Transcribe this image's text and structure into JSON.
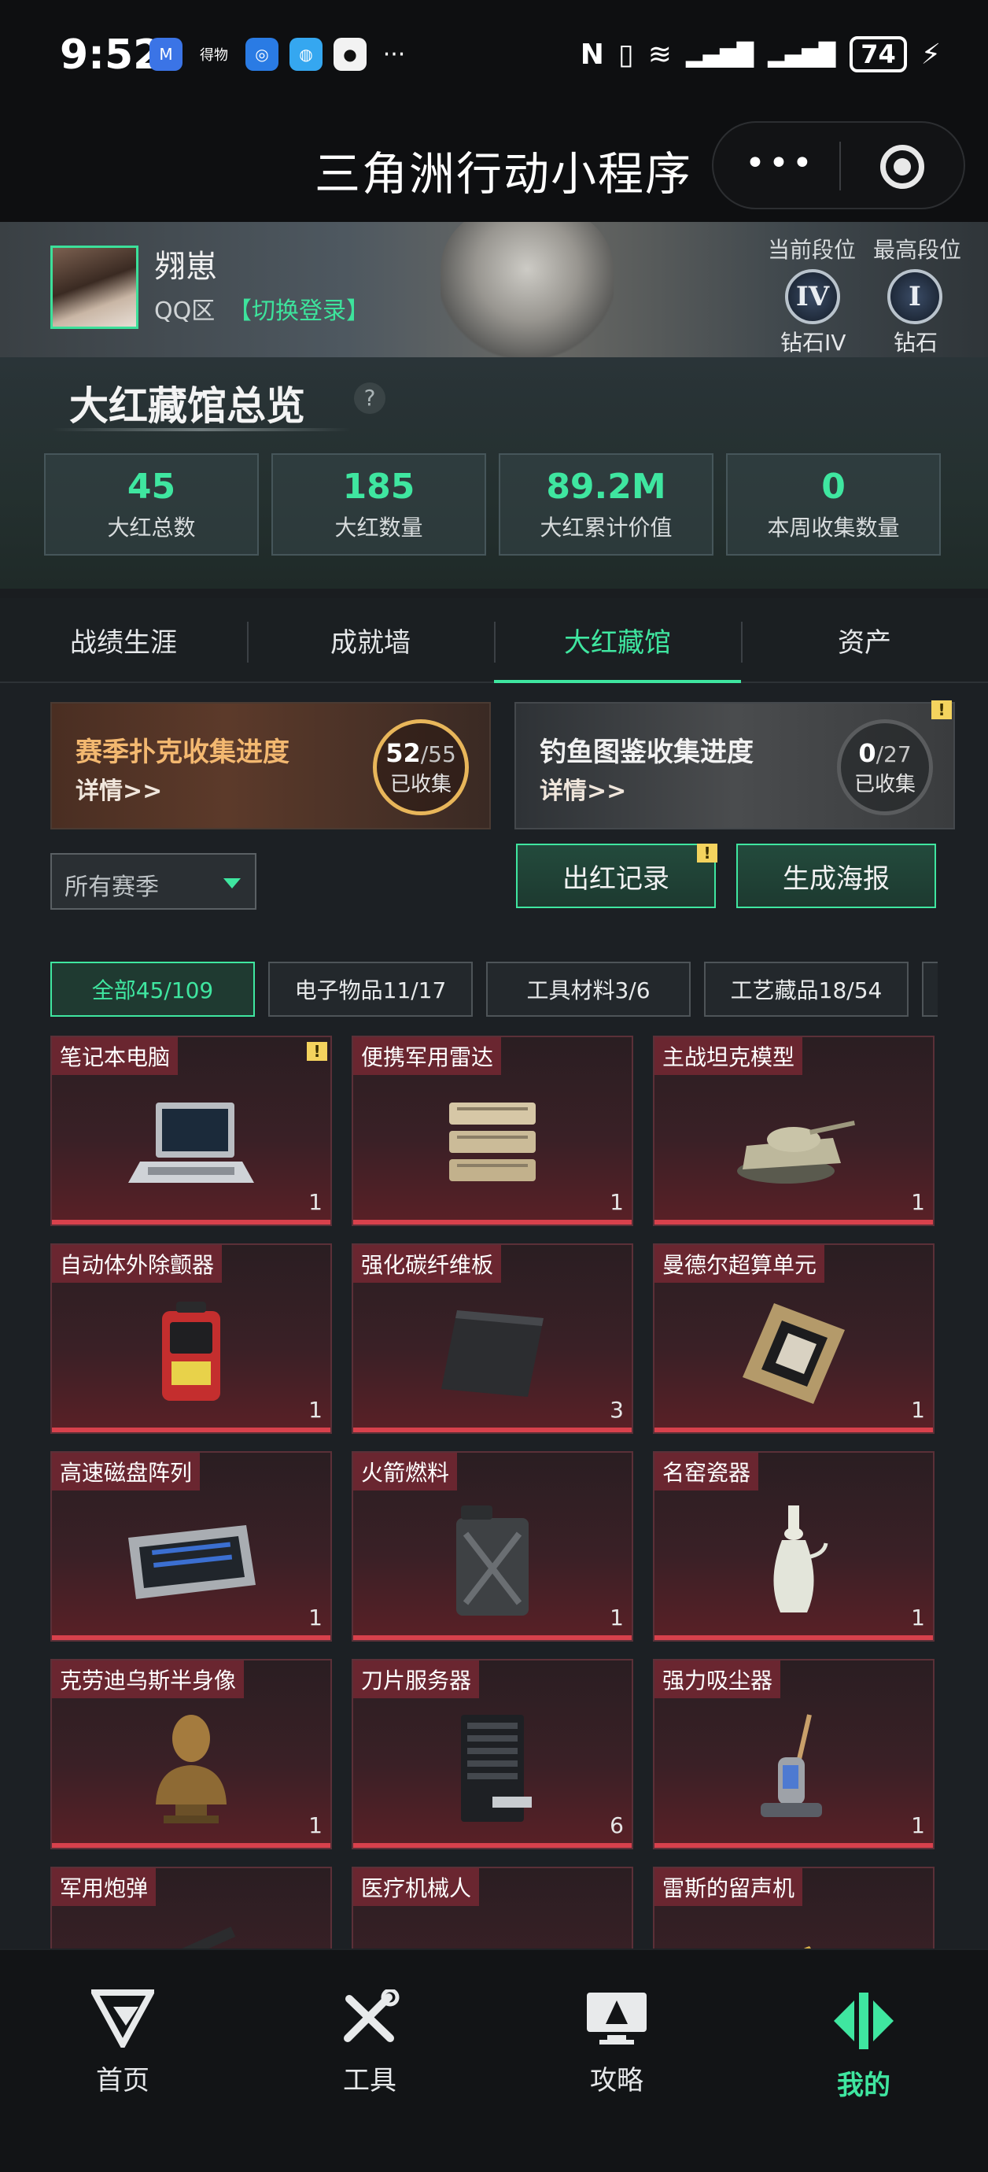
{
  "status_bar": {
    "time": "9:52",
    "apps": [
      {
        "name": "jd-icon",
        "glyph": "M",
        "color": "#3b74e6"
      },
      {
        "name": "dewu-icon",
        "glyph": "得物",
        "color": "#0e0f11"
      },
      {
        "name": "app-blue-icon",
        "glyph": "◎",
        "color": "#2a7be4"
      },
      {
        "name": "browser-icon",
        "glyph": "◍",
        "color": "#35a7f0"
      },
      {
        "name": "qq-icon",
        "glyph": "●",
        "color": "#f2f2f2"
      }
    ],
    "more": "···",
    "nfc": "N",
    "vibrate": "▯",
    "wifi": "≋",
    "signal1": "▂▄▆█",
    "signal2": "▂▄▆█",
    "battery": "74",
    "charging": "⚡"
  },
  "title_bar": {
    "title": "三角洲行动小程序",
    "more": "•••"
  },
  "profile": {
    "username": "翙崽",
    "region": "QQ区",
    "switch_login": "【切换登录】",
    "current_rank_label": "当前段位",
    "best_rank_label": "最高段位",
    "current_rank_badge": "IV",
    "best_rank_badge": "I",
    "current_rank_name": "钻石IV",
    "best_rank_name": "钻石"
  },
  "overview": {
    "title": "大红藏馆总览",
    "help": "?",
    "stats": [
      {
        "value": "45",
        "label": "大红总数"
      },
      {
        "value": "185",
        "label": "大红数量"
      },
      {
        "value": "89.2M",
        "label": "大红累计价值"
      },
      {
        "value": "0",
        "label": "本周收集数量"
      }
    ]
  },
  "tabs": [
    {
      "label": "战绩生涯",
      "active": false
    },
    {
      "label": "成就墙",
      "active": false
    },
    {
      "label": "大红藏馆",
      "active": true
    },
    {
      "label": "资产",
      "active": false
    }
  ],
  "progress": {
    "poker": {
      "title": "赛季扑克收集进度",
      "detail": "详情>>",
      "count": "52",
      "total": "/55",
      "label": "已收集"
    },
    "fish": {
      "title": "钓鱼图鉴收集进度",
      "detail": "详情>>",
      "count": "0",
      "total": "/27",
      "label": "已收集"
    }
  },
  "season_select": {
    "value": "所有赛季"
  },
  "actions": {
    "records": "出红记录",
    "poster": "生成海报"
  },
  "warn_glyph": "!",
  "categories": [
    {
      "label": "全部45/109",
      "active": true
    },
    {
      "label": "电子物品11/17",
      "active": false
    },
    {
      "label": "工具材料3/6",
      "active": false
    },
    {
      "label": "工艺藏品18/54",
      "active": false
    }
  ],
  "items": [
    {
      "name": "笔记本电脑",
      "count": "1",
      "icon": "laptop-icon",
      "warn": true
    },
    {
      "name": "便携军用雷达",
      "count": "1",
      "icon": "radar-icon"
    },
    {
      "name": "主战坦克模型",
      "count": "1",
      "icon": "tank-icon"
    },
    {
      "name": "自动体外除颤器",
      "count": "1",
      "icon": "defibrillator-icon"
    },
    {
      "name": "强化碳纤维板",
      "count": "3",
      "icon": "carbon-plate-icon"
    },
    {
      "name": "曼德尔超算单元",
      "count": "1",
      "icon": "computing-unit-icon"
    },
    {
      "name": "高速磁盘阵列",
      "count": "1",
      "icon": "disk-array-icon"
    },
    {
      "name": "火箭燃料",
      "count": "1",
      "icon": "fuel-can-icon"
    },
    {
      "name": "名窑瓷器",
      "count": "1",
      "icon": "porcelain-icon"
    },
    {
      "name": "克劳迪乌斯半身像",
      "count": "1",
      "icon": "bust-icon"
    },
    {
      "name": "刀片服务器",
      "count": "6",
      "icon": "server-icon"
    },
    {
      "name": "强力吸尘器",
      "count": "1",
      "icon": "vacuum-icon"
    },
    {
      "name": "军用炮弹",
      "count": "",
      "icon": "shell-icon"
    },
    {
      "name": "医疗机械人",
      "count": "",
      "icon": "robot-icon"
    },
    {
      "name": "雷斯的留声机",
      "count": "",
      "icon": "gramophone-icon"
    }
  ],
  "bottom_nav": [
    {
      "label": "首页",
      "icon": "home-icon",
      "active": false
    },
    {
      "label": "工具",
      "icon": "tools-icon",
      "active": false
    },
    {
      "label": "攻略",
      "icon": "guide-icon",
      "active": false
    },
    {
      "label": "我的",
      "icon": "mine-icon",
      "active": true
    }
  ],
  "colors": {
    "accent": "#3fe6a0",
    "item_red": "#d8414c",
    "poker_gold": "#e8b65a"
  }
}
